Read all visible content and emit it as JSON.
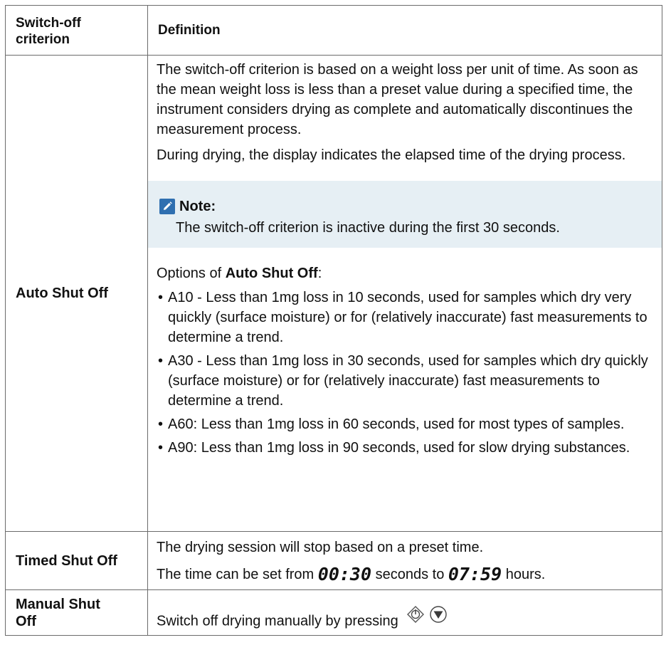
{
  "table": {
    "header": {
      "col1": "Switch-off criterion",
      "col1_line1": "Switch-off",
      "col1_line2": "criterion",
      "col2": "Definition"
    },
    "rows": [
      {
        "criterion": "Auto Shut Off",
        "paragraphs": [
          "The switch-off criterion is based on a weight loss per unit of time. As soon as the mean weight loss is less than a preset value during a specified time, the instrument considers drying as complete and automatically discontinues the measurement process.",
          "During drying, the display indicates the elapsed time of the drying process."
        ],
        "note": {
          "title": "Note:",
          "text": "The switch-off criterion is inactive during the first 30 seconds."
        },
        "options_prefix": "Options of ",
        "options_bold": "Auto Shut Off",
        "options_suffix": ":",
        "options": [
          "A10 - Less than 1mg loss in 10 seconds, used for samples which dry very quickly (surface moisture) or for (relatively inaccurate) fast measurements to determine a trend.",
          "A30 - Less than 1mg loss in 30 seconds, used for samples which dry quickly (surface moisture) or for (relatively inaccurate) fast measurements to determine a trend.",
          "A60: Less than 1mg loss in 60 seconds, used for most types of samples.",
          "A90: Less than 1mg loss in 90 seconds, used for slow drying substances."
        ],
        "bullet": "•"
      },
      {
        "criterion": "Timed Shut Off",
        "line1": "The drying session will stop based on a preset time.",
        "line2_a": "The time can be set from ",
        "time_min": "00:30",
        "line2_b": " seconds to ",
        "time_max": "07:59",
        "line2_c": " hours."
      },
      {
        "criterion_line1": "Manual Shut",
        "criterion_line2": "Off",
        "text": "Switch off drying manually by pressing",
        "icons": [
          "start-stop-button-icon",
          "down-triangle-button-icon"
        ]
      }
    ]
  },
  "colors": {
    "border": "#6b6b6b",
    "note_bg": "#e6eff4",
    "note_icon": "#2f6fb0"
  }
}
